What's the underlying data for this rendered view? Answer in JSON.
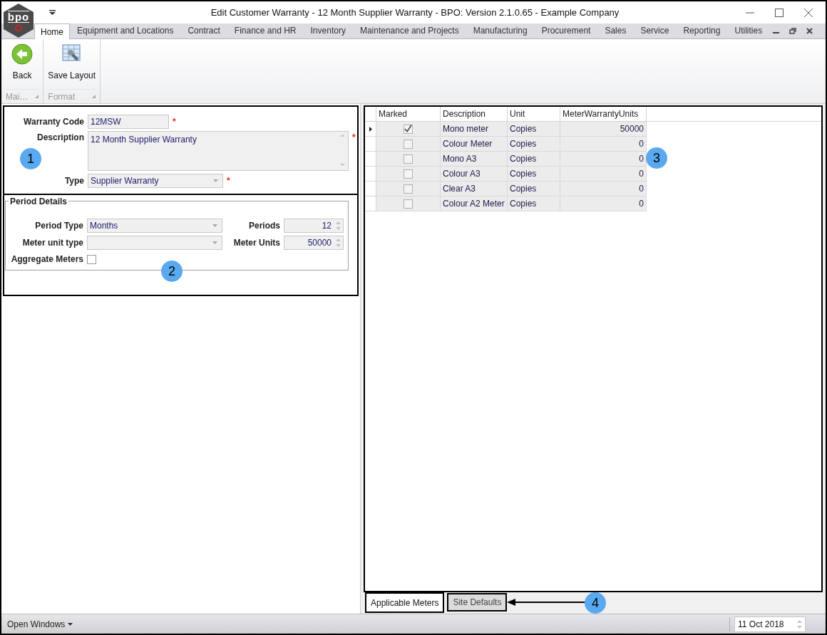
{
  "window": {
    "title": "Edit Customer Warranty - 12 Month Supplier Warranty - BPO: Version 2.1.0.65 - Example Company",
    "logo_text": "bpo"
  },
  "ribbon_tabs": [
    {
      "label": "Home",
      "selected": true
    },
    {
      "label": "Equipment and Locations",
      "selected": false
    },
    {
      "label": "Contract",
      "selected": false
    },
    {
      "label": "Finance and HR",
      "selected": false
    },
    {
      "label": "Inventory",
      "selected": false
    },
    {
      "label": "Maintenance and Projects",
      "selected": false
    },
    {
      "label": "Manufacturing",
      "selected": false
    },
    {
      "label": "Procurement",
      "selected": false
    },
    {
      "label": "Sales",
      "selected": false
    },
    {
      "label": "Service",
      "selected": false
    },
    {
      "label": "Reporting",
      "selected": false
    },
    {
      "label": "Utilities",
      "selected": false
    }
  ],
  "ribbon_groups": [
    {
      "caption": "Mai…",
      "button": {
        "label": "Back",
        "kind": "back"
      }
    },
    {
      "caption": "Format",
      "button": {
        "label": "Save Layout",
        "kind": "layout"
      }
    }
  ],
  "header_fields": [
    {
      "label": "Warranty Code",
      "kind": "text",
      "value": "12MSW",
      "required_mark": "*"
    },
    {
      "label": "Description",
      "kind": "memo",
      "value": "12 Month Supplier Warranty",
      "required_mark": "*"
    },
    {
      "label": "Type",
      "kind": "combo",
      "value": "Supplier Warranty",
      "required_mark": "*"
    }
  ],
  "period_details": {
    "title": "Period Details",
    "fields": [
      {
        "label": "Period Type",
        "kind": "combo",
        "value": "Months"
      },
      {
        "label": "Periods",
        "kind": "spin",
        "value": "12"
      },
      {
        "label": "Meter unit type",
        "kind": "combo"
      },
      {
        "label": "Meter Units",
        "kind": "spin",
        "value": "50000"
      },
      {
        "label": "Aggregate Meters",
        "kind": "check",
        "checked": false
      }
    ]
  },
  "grid": {
    "columns": [
      "Marked",
      "Description",
      "Unit",
      "MeterWarrantyUnits"
    ],
    "rows": [
      {
        "marked": true,
        "description": "Mono meter",
        "unit": "Copies",
        "units": "50000",
        "current": true
      },
      {
        "marked": false,
        "description": "Colour Meter",
        "unit": "Copies",
        "units": "0",
        "current": false
      },
      {
        "marked": false,
        "description": "Mono A3",
        "unit": "Copies",
        "units": "0",
        "current": false
      },
      {
        "marked": false,
        "description": "Colour A3",
        "unit": "Copies",
        "units": "0",
        "current": false
      },
      {
        "marked": false,
        "description": "Clear A3",
        "unit": "Copies",
        "units": "0",
        "current": false
      },
      {
        "marked": false,
        "description": "Colour A2 Meter",
        "unit": "Copies",
        "units": "0",
        "current": false
      }
    ]
  },
  "bottom_tabs": [
    {
      "label": "Applicable Meters",
      "selected": true
    },
    {
      "label": "Site Defaults",
      "selected": false
    }
  ],
  "callouts": [
    "1",
    "2",
    "3",
    "4"
  ],
  "status_bar": {
    "open_windows": "Open Windows",
    "date": "11 Oct 2018"
  }
}
